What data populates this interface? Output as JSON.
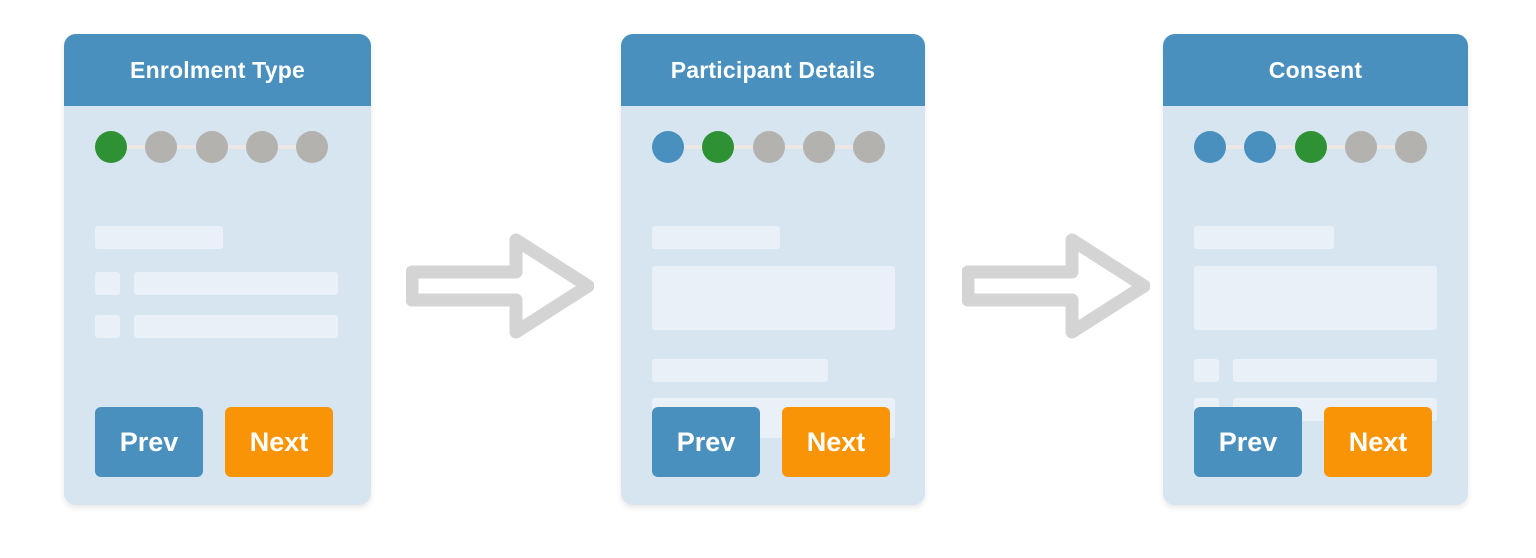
{
  "meta": {
    "accent_blue": "#4a90bf",
    "card_bg": "#d6e5f0",
    "skeleton": "#e9f0f7",
    "step_done": "#4a90bf",
    "step_current": "#2e9133",
    "step_todo": "#b4b2ae",
    "next_orange": "#f89406",
    "arrow_gray": "#d4d4d4"
  },
  "cards": [
    {
      "title": "Enrolment Type",
      "steps": [
        {
          "state": "current",
          "index": 1
        },
        {
          "state": "todo",
          "index": 2
        },
        {
          "state": "todo",
          "index": 3
        },
        {
          "state": "todo",
          "index": 4
        },
        {
          "state": "todo",
          "index": 5
        }
      ],
      "buttons": {
        "prev": "Prev",
        "next": "Next"
      }
    },
    {
      "title": "Participant Details",
      "steps": [
        {
          "state": "done",
          "index": 1
        },
        {
          "state": "current",
          "index": 2
        },
        {
          "state": "todo",
          "index": 3
        },
        {
          "state": "todo",
          "index": 4
        },
        {
          "state": "todo",
          "index": 5
        }
      ],
      "buttons": {
        "prev": "Prev",
        "next": "Next"
      }
    },
    {
      "title": "Consent",
      "steps": [
        {
          "state": "done",
          "index": 1
        },
        {
          "state": "done",
          "index": 2
        },
        {
          "state": "current",
          "index": 3
        },
        {
          "state": "todo",
          "index": 4
        },
        {
          "state": "todo",
          "index": 5
        }
      ],
      "buttons": {
        "prev": "Prev",
        "next": "Next"
      }
    }
  ],
  "arrows": [
    {
      "direction": "right"
    },
    {
      "direction": "right"
    }
  ]
}
